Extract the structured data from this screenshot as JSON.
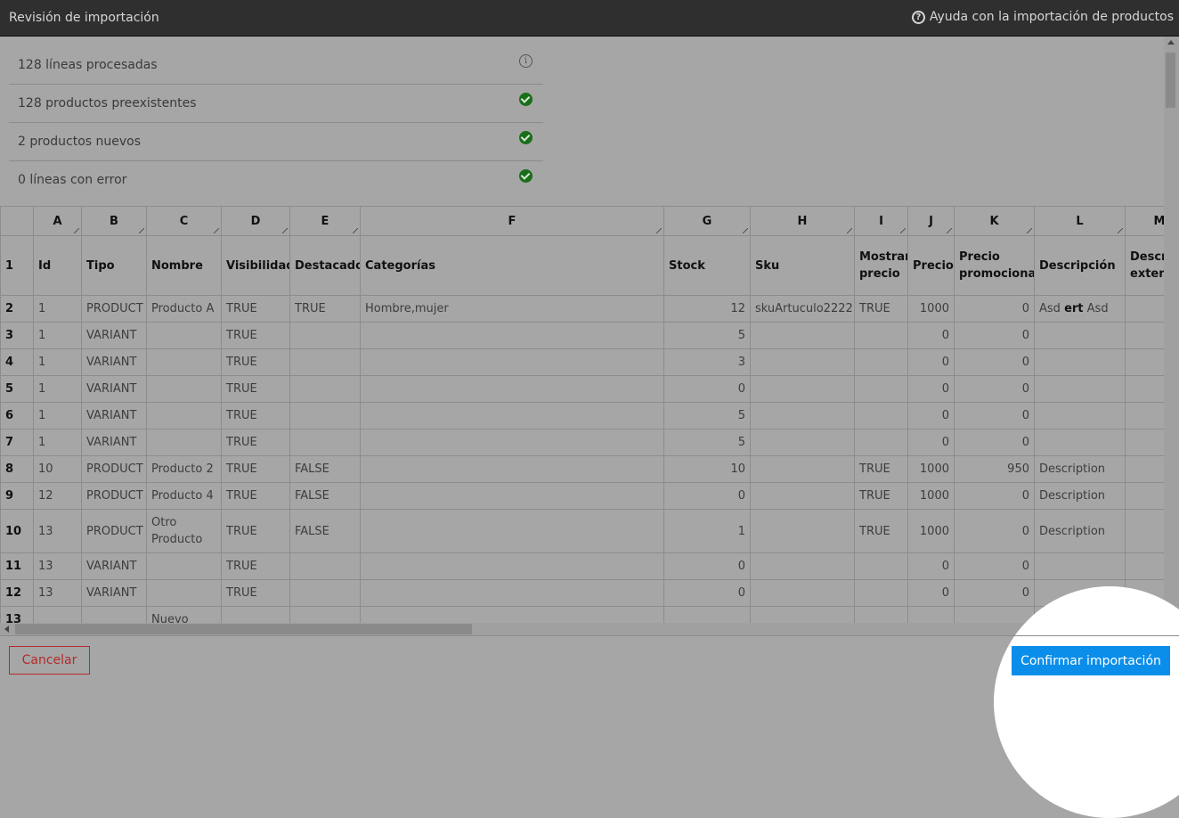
{
  "header": {
    "title": "Revisión de importación",
    "help_link": "Ayuda con la importación de productos"
  },
  "summary": [
    {
      "label": "128 líneas procesadas",
      "icon": "info-icon"
    },
    {
      "label": "128 productos preexistentes",
      "icon": "check-circle-icon"
    },
    {
      "label": "2 productos nuevos",
      "icon": "check-circle-icon"
    },
    {
      "label": "0 líneas con error",
      "icon": "check-circle-icon"
    }
  ],
  "grid": {
    "column_letters": [
      "A",
      "B",
      "C",
      "D",
      "E",
      "F",
      "G",
      "H",
      "I",
      "J",
      "K",
      "L",
      "M"
    ],
    "header_row": {
      "num": "1",
      "cells": [
        "Id",
        "Tipo",
        "Nombre",
        "Visibilidad",
        "Destacado",
        "Categorías",
        "Stock",
        "Sku",
        "Mostrar precio",
        "Precio",
        "Precio promocional",
        "Descripción",
        "Descripción extendida"
      ]
    },
    "rows": [
      {
        "num": "2",
        "cells": [
          "1",
          "PRODUCT",
          "Producto A",
          "TRUE",
          "TRUE",
          "Hombre,mujer",
          "12",
          "skuArtuculo2222",
          "TRUE",
          "1000",
          "0",
          "Asd ert Asd",
          ""
        ]
      },
      {
        "num": "3",
        "cells": [
          "1",
          "VARIANT",
          "",
          "TRUE",
          "",
          "",
          "5",
          "",
          "",
          "0",
          "0",
          "",
          ""
        ]
      },
      {
        "num": "4",
        "cells": [
          "1",
          "VARIANT",
          "",
          "TRUE",
          "",
          "",
          "3",
          "",
          "",
          "0",
          "0",
          "",
          ""
        ]
      },
      {
        "num": "5",
        "cells": [
          "1",
          "VARIANT",
          "",
          "TRUE",
          "",
          "",
          "0",
          "",
          "",
          "0",
          "0",
          "",
          ""
        ]
      },
      {
        "num": "6",
        "cells": [
          "1",
          "VARIANT",
          "",
          "TRUE",
          "",
          "",
          "5",
          "",
          "",
          "0",
          "0",
          "",
          ""
        ]
      },
      {
        "num": "7",
        "cells": [
          "1",
          "VARIANT",
          "",
          "TRUE",
          "",
          "",
          "5",
          "",
          "",
          "0",
          "0",
          "",
          ""
        ]
      },
      {
        "num": "8",
        "cells": [
          "10",
          "PRODUCT",
          "Producto 2",
          "TRUE",
          "FALSE",
          "",
          "10",
          "",
          "TRUE",
          "1000",
          "950",
          "Description",
          ""
        ]
      },
      {
        "num": "9",
        "cells": [
          "12",
          "PRODUCT",
          "Producto 4",
          "TRUE",
          "FALSE",
          "",
          "0",
          "",
          "TRUE",
          "1000",
          "0",
          "Description",
          ""
        ]
      },
      {
        "num": "10",
        "cells": [
          "13",
          "PRODUCT",
          "Otro Producto",
          "TRUE",
          "FALSE",
          "",
          "1",
          "",
          "TRUE",
          "1000",
          "0",
          "Description",
          ""
        ]
      },
      {
        "num": "11",
        "cells": [
          "13",
          "VARIANT",
          "",
          "TRUE",
          "",
          "",
          "0",
          "",
          "",
          "0",
          "0",
          "",
          ""
        ]
      },
      {
        "num": "12",
        "cells": [
          "13",
          "VARIANT",
          "",
          "TRUE",
          "",
          "",
          "0",
          "",
          "",
          "0",
          "0",
          "",
          ""
        ]
      },
      {
        "num": "13",
        "cells": [
          "",
          "",
          "Nuevo",
          "",
          "",
          "",
          "",
          "",
          "",
          "",
          "",
          "",
          ""
        ]
      }
    ]
  },
  "footer": {
    "cancel_label": "Cancelar",
    "confirm_label": "Confirmar importación"
  }
}
